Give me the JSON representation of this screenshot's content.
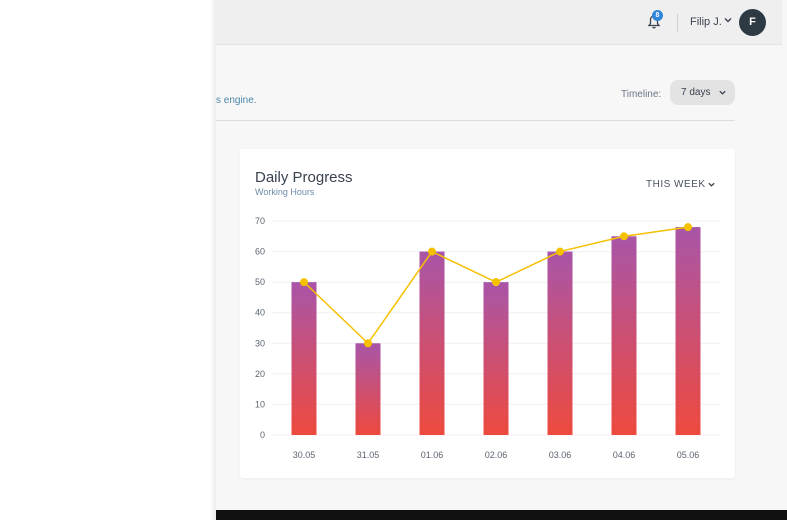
{
  "header": {
    "notification_count": "8",
    "user_name": "Filip J.",
    "avatar_initial": "F"
  },
  "page": {
    "subtitle": "s engine.",
    "timeline_label": "Timeline:",
    "timeline_value": "7 days"
  },
  "card": {
    "title": "Daily Progress",
    "subtitle": "Working Hours",
    "period": "THIS WEEK"
  },
  "colors": {
    "bar_top": "#a855a8",
    "bar_bottom": "#ee4a3e",
    "line": "#f5c000",
    "avatar": "#2d3a44",
    "badge": "#2f86d6"
  },
  "chart_data": {
    "type": "bar",
    "categories": [
      "30.05",
      "31.05",
      "01.06",
      "02.06",
      "03.06",
      "04.06",
      "05.06"
    ],
    "series": [
      {
        "type": "bar",
        "values": [
          50,
          30,
          60,
          50,
          60,
          65,
          68
        ]
      },
      {
        "type": "line",
        "values": [
          50,
          30,
          60,
          50,
          60,
          65,
          68
        ]
      }
    ],
    "y_ticks": [
      0,
      10,
      20,
      30,
      40,
      50,
      60,
      70
    ],
    "ylim": [
      0,
      70
    ],
    "grid": true
  }
}
